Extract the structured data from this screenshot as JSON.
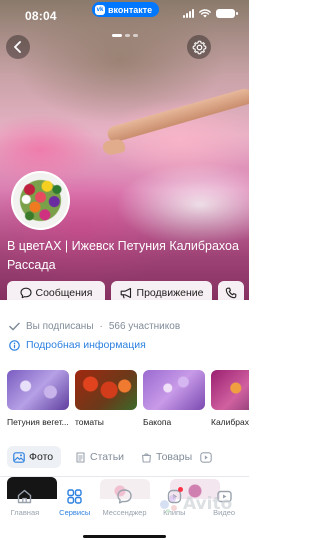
{
  "status_bar": {
    "time": "08:04",
    "app_pill": "вконтакте",
    "app_pill_logo": "vk",
    "battery_level": 1.0
  },
  "cover": {
    "carousel": {
      "pages": 3,
      "active_index": 0
    }
  },
  "group": {
    "name": "В цветАХ | Ижевск Петуния Калибрахоа Рассада"
  },
  "actions": {
    "messages": "Сообщения",
    "promote": "Продвижение"
  },
  "info": {
    "subscribed": "Вы подписаны",
    "members": "566 участников",
    "separator": "·",
    "details": "Подробная информация"
  },
  "products": [
    {
      "label": "Петуния вегет...",
      "image": "purple-petunia-photo"
    },
    {
      "label": "томаты",
      "image": "tomatoes-photo"
    },
    {
      "label": "Бакопа",
      "image": "bacopa-photo"
    },
    {
      "label": "Калибрахо...",
      "image": "calibrachoa-photo"
    }
  ],
  "tabs": {
    "photo": "Фото",
    "articles": "Статьи",
    "goods": "Товары"
  },
  "nav": {
    "items": [
      {
        "label": "Главная",
        "icon": "home-icon"
      },
      {
        "label": "Сервисы",
        "icon": "services-icon"
      },
      {
        "label": "Мессенджер",
        "icon": "messenger-icon"
      },
      {
        "label": "Клипы",
        "icon": "clips-icon"
      },
      {
        "label": "Видео",
        "icon": "video-icon"
      }
    ]
  },
  "watermark": {
    "text": "Avito"
  },
  "colors": {
    "accent": "#2d81e0",
    "vk_blue": "#0077ff",
    "muted": "#818c99",
    "notification": "#ff3347"
  }
}
